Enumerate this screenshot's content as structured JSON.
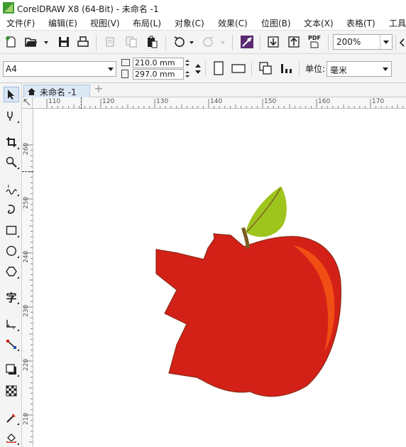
{
  "window": {
    "title": "CorelDRAW X8 (64-Bit) - 未命名 -1"
  },
  "menubar": {
    "items": [
      "文件(F)",
      "编辑(E)",
      "视图(V)",
      "布局(L)",
      "对象(C)",
      "效果(C)",
      "位图(B)",
      "文本(X)",
      "表格(T)",
      "工具"
    ]
  },
  "toolbar": {
    "zoom": "200%",
    "publish_pdf_label": "PDF"
  },
  "property_bar": {
    "page_size": "A4",
    "width": "210.0 mm",
    "height": "297.0 mm",
    "units_label": "单位:",
    "units_value": "毫米"
  },
  "document_tab": {
    "label": "未命名 -1",
    "add_tab": "+"
  },
  "rulers": {
    "horizontal": [
      "110",
      "120",
      "130",
      "140",
      "150",
      "160",
      "170"
    ],
    "vertical": [
      "260",
      "250",
      "240",
      "230",
      "220",
      "210"
    ]
  },
  "toolbox": {
    "tools": [
      "pick-tool",
      "shape-tool",
      "crop-tool",
      "zoom-tool",
      "freehand-tool",
      "artistic-media-tool",
      "rectangle-tool",
      "ellipse-tool",
      "polygon-tool",
      "text-tool",
      "parallel-dimension-tool",
      "connector-tool",
      "drop-shadow-tool",
      "transparency-tool",
      "eyedropper-tool",
      "fill-tool"
    ],
    "text_tool_glyph": "字"
  },
  "artwork": {
    "apple_color": "#d42118",
    "highlight_color": "#f04e14",
    "leaf_color": "#9ec41e",
    "stem_color": "#7a5a24",
    "outline_color": "#8c2a16"
  }
}
